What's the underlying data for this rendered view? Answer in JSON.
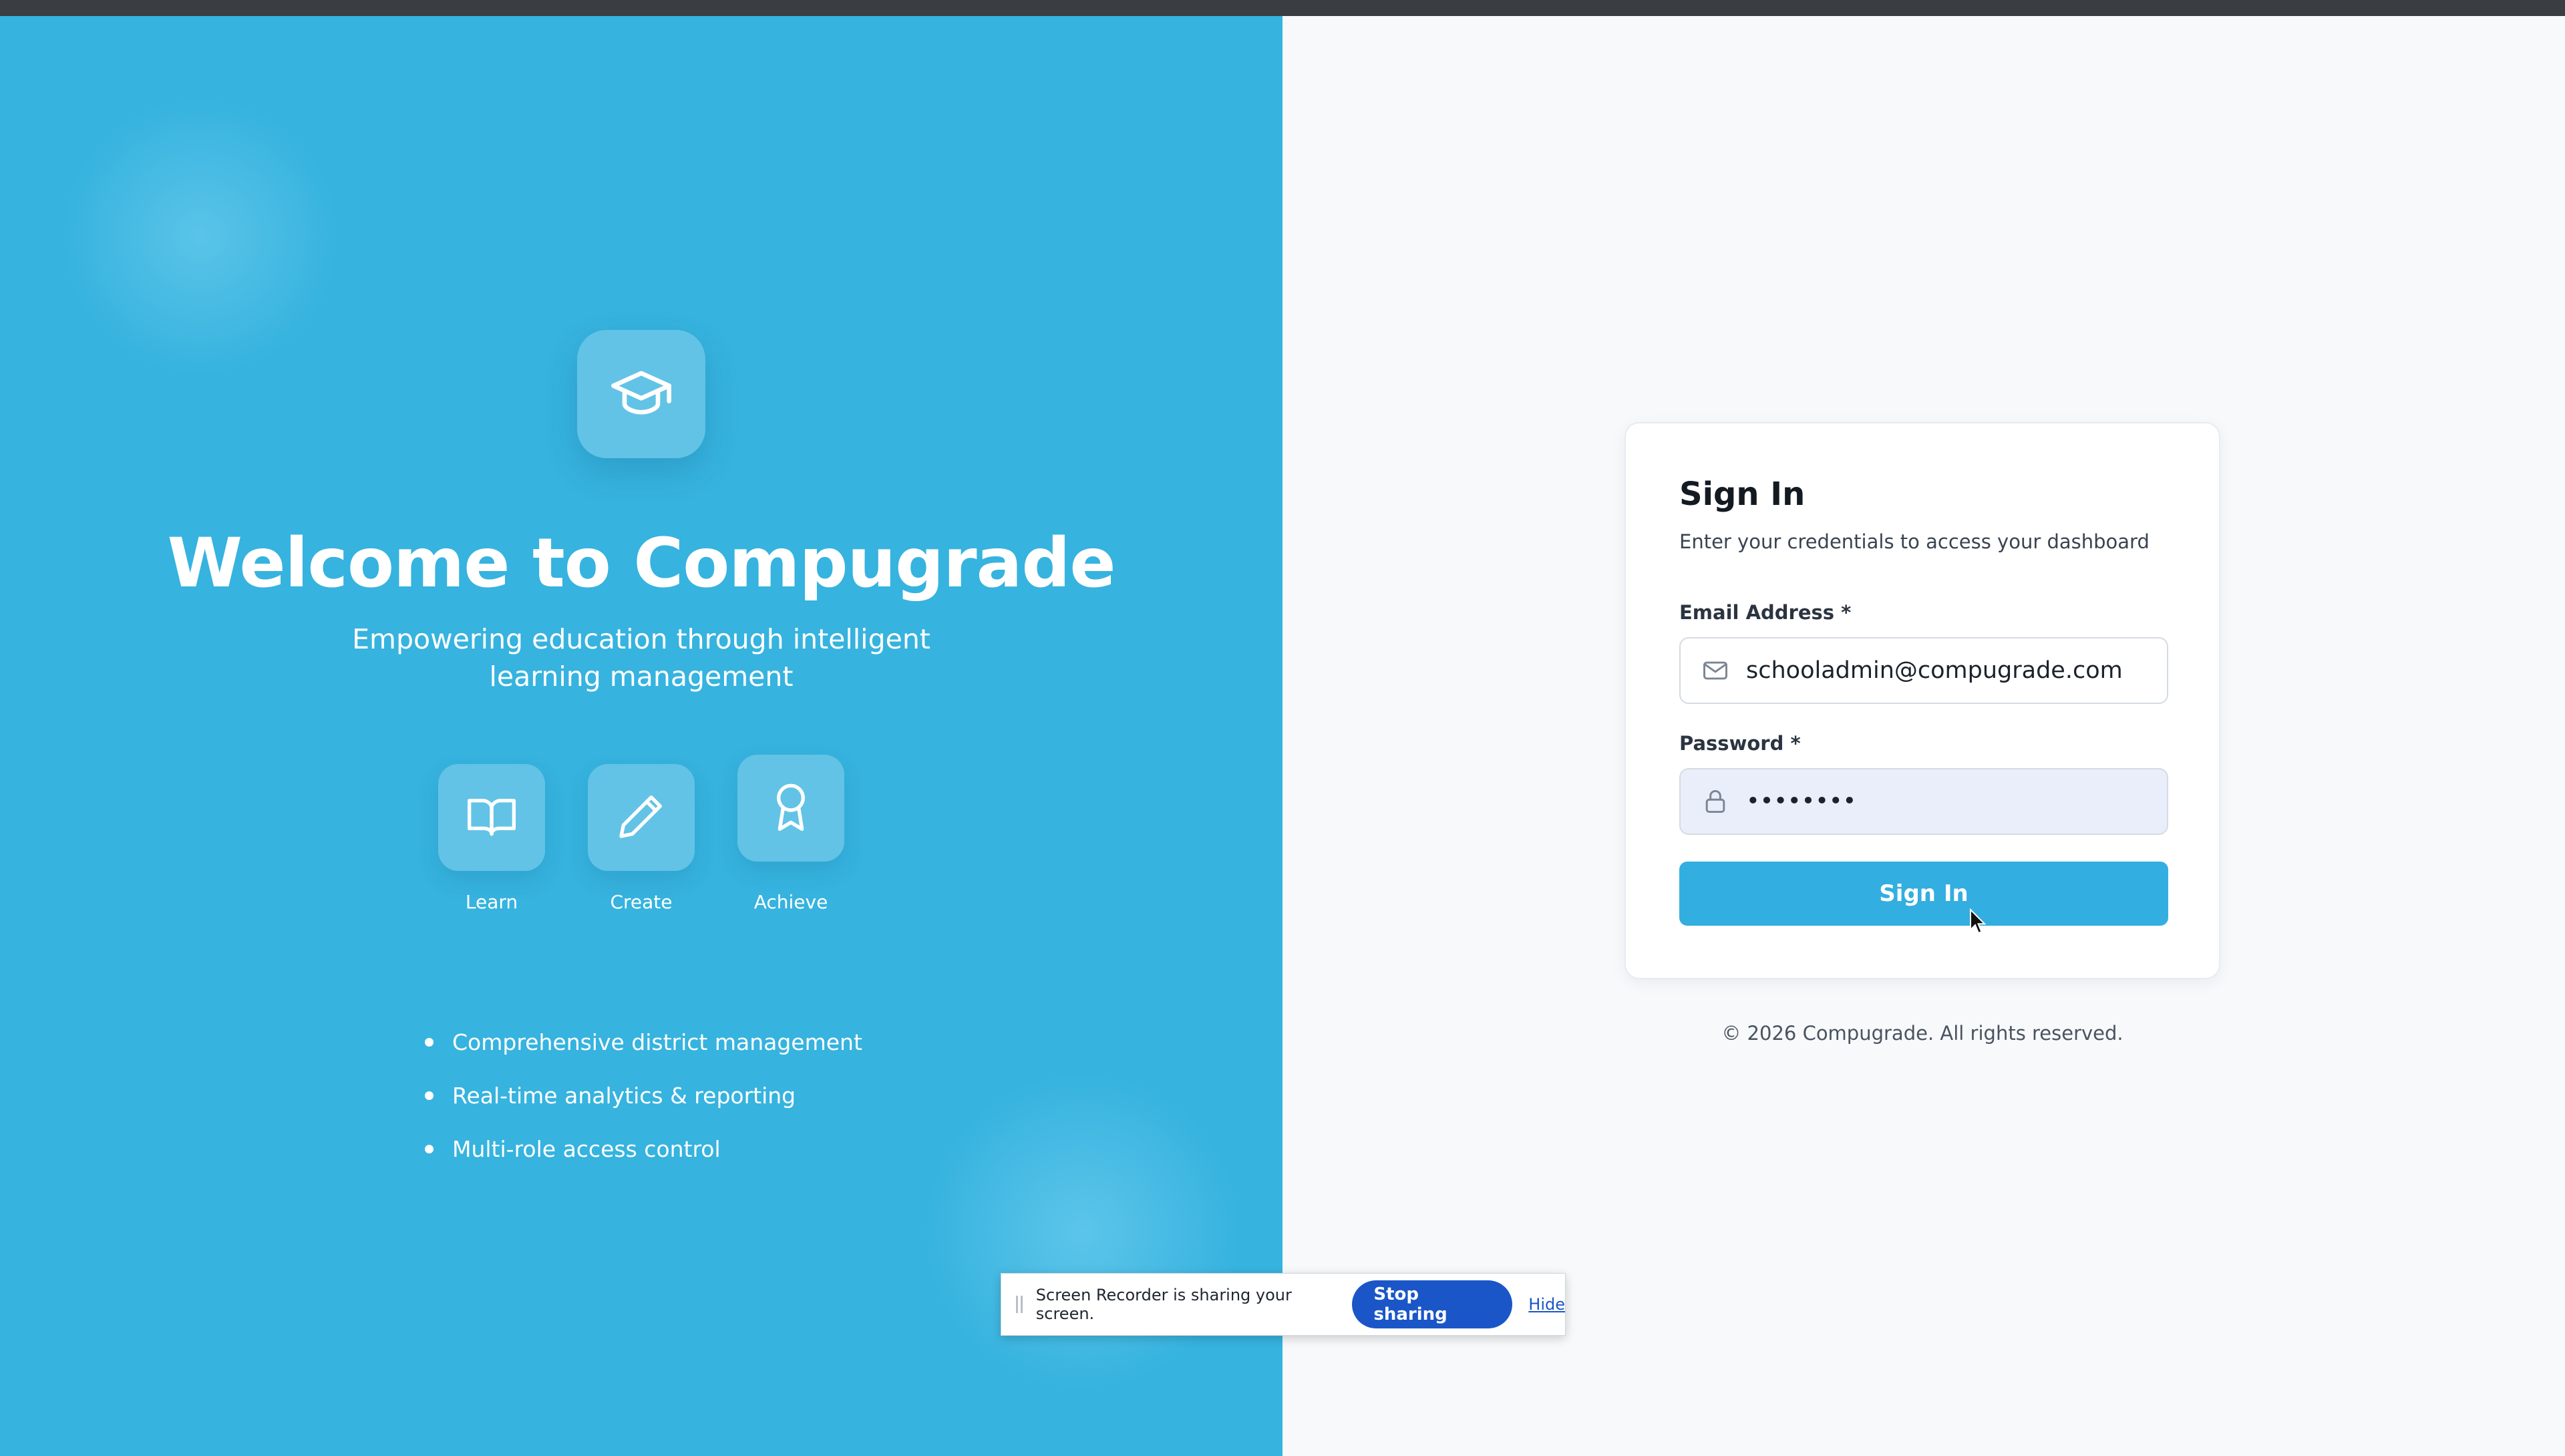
{
  "hero": {
    "title": "Welcome to Compugrade",
    "tagline_line1": "Empowering education through intelligent",
    "tagline_line2": "learning management",
    "features": [
      {
        "label": "Learn",
        "icon": "book-icon"
      },
      {
        "label": "Create",
        "icon": "pencil-icon"
      },
      {
        "label": "Achieve",
        "icon": "award-icon"
      }
    ],
    "bullets": [
      "Comprehensive district management",
      "Real-time analytics & reporting",
      "Multi-role access control"
    ]
  },
  "login": {
    "title": "Sign In",
    "subtitle": "Enter your credentials to access your dashboard",
    "email_label": "Email Address *",
    "email_value": "schooladmin@compugrade.com",
    "password_label": "Password *",
    "password_value": "••••••••",
    "submit_label": "Sign In"
  },
  "footer": {
    "copyright": "© 2026 Compugrade. All rights reserved."
  },
  "share_bar": {
    "message": "Screen Recorder is sharing your screen.",
    "stop_label": "Stop sharing",
    "hide_label": "Hide"
  },
  "colors": {
    "brand": "#36b3df",
    "button": "#33aee0",
    "stop_button": "#1a56c7"
  }
}
